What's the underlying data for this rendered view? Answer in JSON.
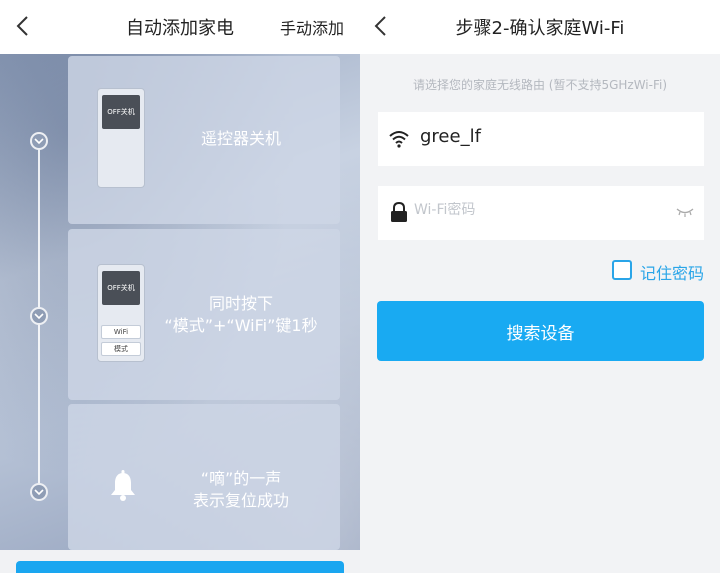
{
  "left_screen": {
    "title": "自动添加家电",
    "manual_add": "手动添加",
    "steps": [
      {
        "text_lines": [
          "遥控器关机"
        ],
        "remote_screen": "OFF关机"
      },
      {
        "text_lines": [
          "同时按下",
          "“模式”+“WiFi”键1秒"
        ],
        "remote_screen": "OFF关机",
        "remote_buttons": [
          "WiFi",
          "模式"
        ]
      },
      {
        "text_lines": [
          "“嘀”的一声",
          "表示复位成功"
        ],
        "icon": "bell-icon"
      }
    ]
  },
  "right_screen": {
    "title": "步骤2-确认家庭Wi-Fi",
    "hint": "请选择您的家庭无线路由 (暂不支持5GHzWi-Fi)",
    "ssid": "gree_lf",
    "password_placeholder": "Wi-Fi密码",
    "remember_label": "记住密码",
    "remember_checked": false,
    "search_button": "搜索设备"
  },
  "colors": {
    "accent": "#19aaf2",
    "checkbox": "#2aa5e8"
  }
}
